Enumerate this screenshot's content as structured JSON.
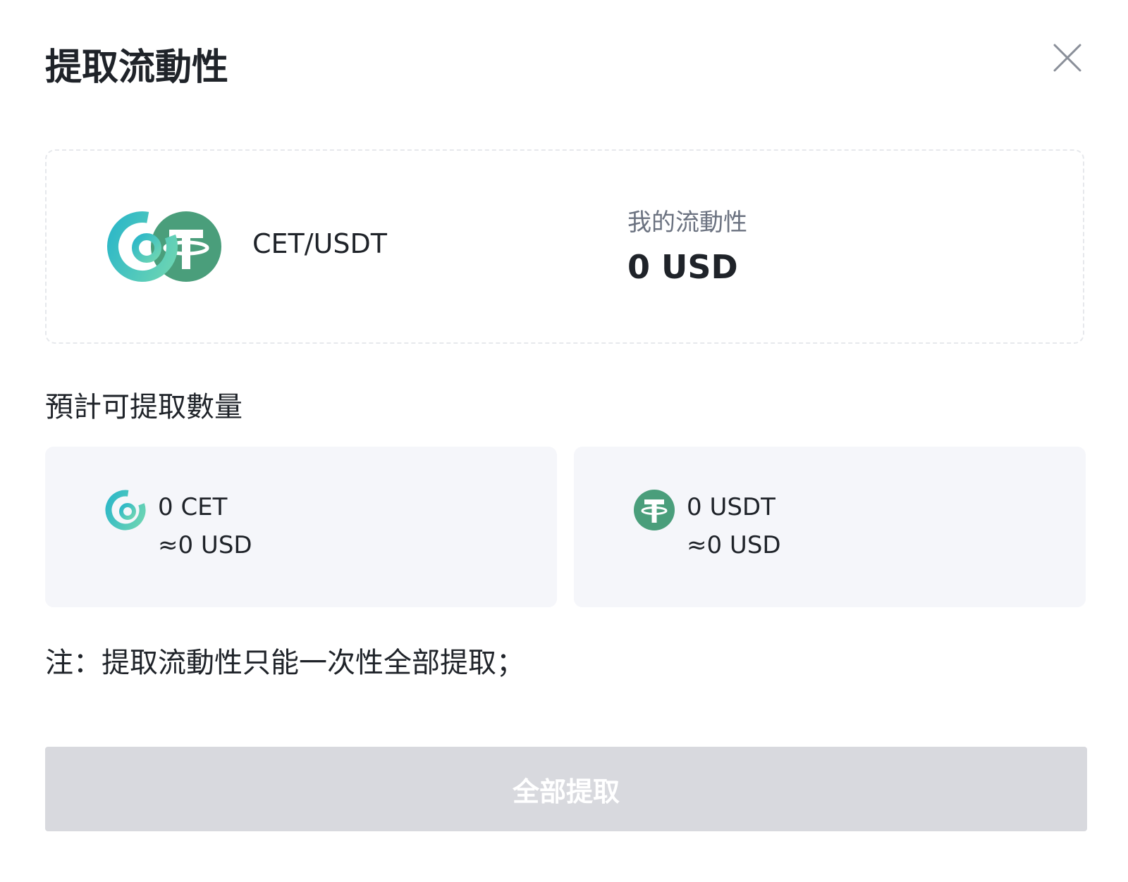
{
  "modal": {
    "title": "提取流動性",
    "close_icon": "close-icon"
  },
  "pair": {
    "name": "CET/USDT",
    "my_liquidity_label": "我的流動性",
    "my_liquidity_value": "0 USD",
    "icons": [
      "cet-icon",
      "usdt-icon"
    ]
  },
  "estimate": {
    "label": "預計可提取數量",
    "assets": [
      {
        "icon": "cet-icon",
        "amount": "0 CET",
        "usd": "≈0 USD"
      },
      {
        "icon": "usdt-icon",
        "amount": "0 USDT",
        "usd": "≈0 USD"
      }
    ]
  },
  "note": "注：提取流動性只能一次性全部提取；",
  "withdraw_button": {
    "label": "全部提取",
    "disabled": true
  },
  "colors": {
    "cet_gradient_start": "#29b6c9",
    "cet_gradient_end": "#6fd6b2",
    "usdt_green": "#4a9e7b",
    "button_disabled_bg": "#d8d9de",
    "asset_box_bg": "#f5f6fa",
    "dashed_border": "#e6e8ec"
  }
}
